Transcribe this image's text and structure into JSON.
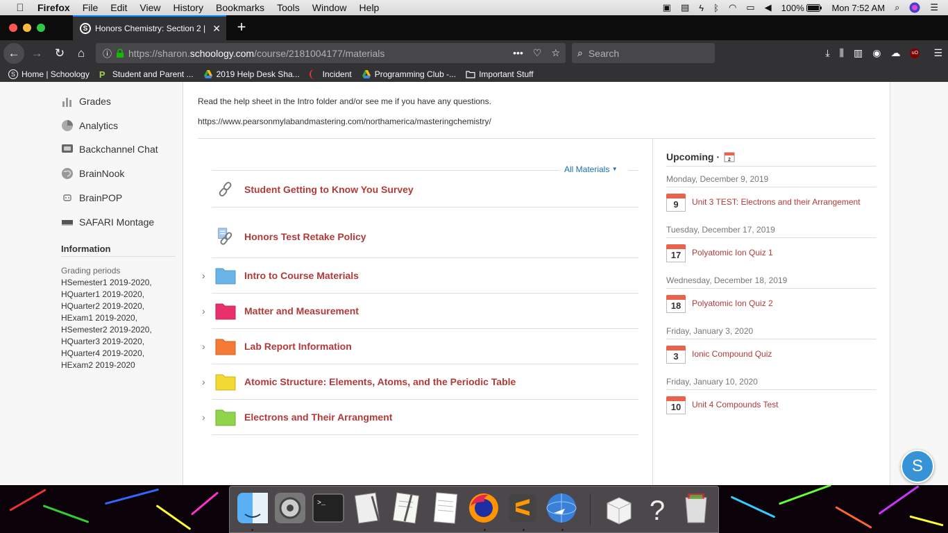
{
  "menubar": {
    "app_name": "Firefox",
    "items": [
      "File",
      "Edit",
      "View",
      "History",
      "Bookmarks",
      "Tools",
      "Window",
      "Help"
    ],
    "battery": "100%",
    "clock": "Mon 7:52 AM"
  },
  "browser": {
    "tab_title": "Honors Chemistry: Section 2 | S",
    "url_prefix": "https://sharon.",
    "url_domain": "schoology.com",
    "url_path": "/course/2181004177/materials",
    "search_placeholder": "Search",
    "bookmarks": [
      "Home | Schoology",
      "Student and Parent ...",
      "2019 Help Desk Sha...",
      "Incident",
      "Programming Club -...",
      "Important Stuff"
    ]
  },
  "sidebar": {
    "items": [
      "Grades",
      "Analytics",
      "Backchannel Chat",
      "BrainNook",
      "BrainPOP",
      "SAFARI Montage"
    ],
    "info_heading": "Information",
    "grading_heading": "Grading periods",
    "grading_periods": [
      "HSemester1 2019-2020,",
      "HQuarter1 2019-2020,",
      "HQuarter2 2019-2020,",
      "HExam1 2019-2020,",
      "HSemester2 2019-2020,",
      "HQuarter3 2019-2020,",
      "HQuarter4 2019-2020,",
      "HExam2 2019-2020"
    ]
  },
  "main": {
    "intro_text": "Read the help sheet in the Intro folder and/or see me if you have any questions.",
    "intro_link": "https://www.pearsonmylabandmastering.com/northamerica/masteringchemistry/",
    "filter_label": "All Materials",
    "materials": [
      {
        "title": "Student Getting to Know You Survey",
        "kind": "link-icon"
      },
      {
        "title": "Honors Test Retake Policy",
        "kind": "document-link-icon"
      },
      {
        "title": "Intro to Course Materials",
        "kind": "folder-icon",
        "color": "#6ab4e8"
      },
      {
        "title": "Matter and Measurement",
        "kind": "folder-icon",
        "color": "#e8316a"
      },
      {
        "title": "Lab Report Information",
        "kind": "folder-icon",
        "color": "#f47a35"
      },
      {
        "title": "Atomic Structure: Elements, Atoms, and the Periodic Table",
        "kind": "folder-icon",
        "color": "#f2d934"
      },
      {
        "title": "Electrons and Their Arrangment",
        "kind": "folder-icon",
        "color": "#8fd44b"
      }
    ]
  },
  "upcoming": {
    "title": "Upcoming",
    "separator": "·",
    "count": "2",
    "events": [
      {
        "date": "Monday, December 9, 2019",
        "day": "9",
        "title": "Unit 3 TEST: Electrons and their Arrangement"
      },
      {
        "date": "Tuesday, December 17, 2019",
        "day": "17",
        "title": "Polyatomic Ion Quiz 1"
      },
      {
        "date": "Wednesday, December 18, 2019",
        "day": "18",
        "title": "Polyatomic Ion Quiz 2"
      },
      {
        "date": "Friday, January 3, 2020",
        "day": "3",
        "title": "Ionic Compound Quiz"
      },
      {
        "date": "Friday, January 10, 2020",
        "day": "10",
        "title": "Unit 4 Compounds Test"
      }
    ]
  },
  "fab_label": "S",
  "colors": {
    "accent_red": "#b33939",
    "link_blue": "#1c6eb4",
    "schoology_blue": "#3694d6"
  }
}
